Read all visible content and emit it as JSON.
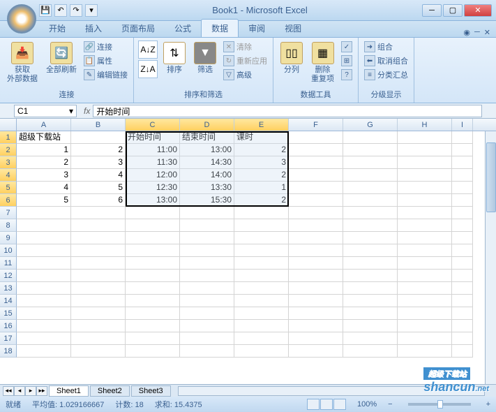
{
  "title": "Book1 - Microsoft Excel",
  "qat": {
    "save": "💾",
    "undo": "↶",
    "redo": "↷"
  },
  "tabs": {
    "t0": "开始",
    "t1": "插入",
    "t2": "页面布局",
    "t3": "公式",
    "t4": "数据",
    "t5": "审阅",
    "t6": "视图"
  },
  "ribbon": {
    "g1": {
      "label": "连接",
      "btn1": "获取\n外部数据",
      "btn2": "全部刷新",
      "s1": "连接",
      "s2": "属性",
      "s3": "编辑链接"
    },
    "g2": {
      "label": "排序和筛选",
      "az": "A↓Z",
      "za": "Z↓A",
      "sort": "排序",
      "filter": "筛选",
      "s1": "清除",
      "s2": "重新应用",
      "s3": "高级"
    },
    "g3": {
      "label": "数据工具",
      "btn1": "分列",
      "btn2": "删除\n重复项"
    },
    "g4": {
      "label": "分级显示",
      "s1": "组合",
      "s2": "取消组合",
      "s3": "分类汇总"
    }
  },
  "namebox": "C1",
  "formula": "开始时间",
  "cols": [
    "A",
    "B",
    "C",
    "D",
    "E",
    "F",
    "G",
    "H",
    "I"
  ],
  "rows": [
    "1",
    "2",
    "3",
    "4",
    "5",
    "6",
    "7",
    "8",
    "9",
    "10",
    "11",
    "12",
    "13",
    "14",
    "15",
    "16",
    "17",
    "18"
  ],
  "chart_data": {
    "type": "table",
    "headers_row1": {
      "A": "超级下载站",
      "C": "开始时间",
      "D": "结束时间",
      "E": "课时"
    },
    "data": [
      {
        "A": "1",
        "B": "2",
        "C": "11:00",
        "D": "13:00",
        "E": "2"
      },
      {
        "A": "2",
        "B": "3",
        "C": "11:30",
        "D": "14:30",
        "E": "3"
      },
      {
        "A": "3",
        "B": "4",
        "C": "12:00",
        "D": "14:00",
        "E": "2"
      },
      {
        "A": "4",
        "B": "5",
        "C": "12:30",
        "D": "13:30",
        "E": "1"
      },
      {
        "A": "5",
        "B": "6",
        "C": "13:00",
        "D": "15:30",
        "E": "2"
      }
    ]
  },
  "sheets": {
    "s1": "Sheet1",
    "s2": "Sheet2",
    "s3": "Sheet3"
  },
  "status": {
    "ready": "就绪",
    "avg": "平均值: 1.029166667",
    "count": "计数: 18",
    "sum": "求和: 15.4375",
    "zoom": "100%"
  },
  "watermark": {
    "top": "超级下载站",
    "main": "shancun",
    "suffix": ".net"
  }
}
